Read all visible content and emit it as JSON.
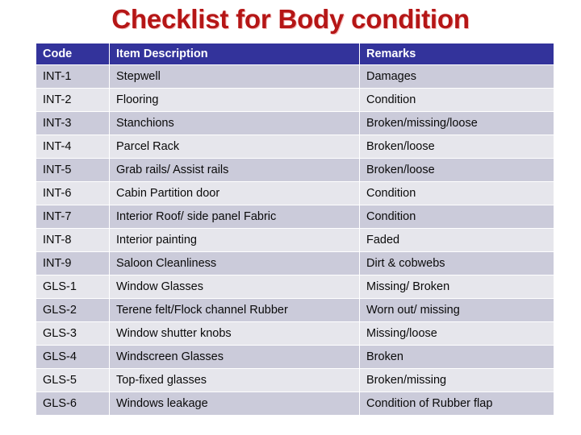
{
  "title": "Checklist for Body condition",
  "colors": {
    "title_text": "#b51616",
    "title_shadow": "#f3b9b9",
    "header_bg": "#33339b",
    "header_text": "#ffffff",
    "row_odd_bg": "#cbcbda",
    "row_even_bg": "#e6e6ec",
    "page_bg": "#ffffff",
    "cell_text": "#0a0a0a"
  },
  "table": {
    "columns": [
      "Code",
      "Item Description",
      "Remarks"
    ],
    "rows": [
      {
        "code": "INT-1",
        "description": "Stepwell",
        "remarks": "Damages"
      },
      {
        "code": "INT-2",
        "description": "Flooring",
        "remarks": "Condition"
      },
      {
        "code": "INT-3",
        "description": "Stanchions",
        "remarks": "Broken/missing/loose"
      },
      {
        "code": "INT-4",
        "description": "Parcel Rack",
        "remarks": "Broken/loose"
      },
      {
        "code": "INT-5",
        "description": "Grab rails/ Assist rails",
        "remarks": "Broken/loose"
      },
      {
        "code": "INT-6",
        "description": "Cabin Partition door",
        "remarks": "Condition"
      },
      {
        "code": "INT-7",
        "description": "Interior Roof/ side panel Fabric",
        "remarks": "Condition"
      },
      {
        "code": "INT-8",
        "description": "Interior painting",
        "remarks": "Faded"
      },
      {
        "code": "INT-9",
        "description": "Saloon Cleanliness",
        "remarks": "Dirt & cobwebs"
      },
      {
        "code": "GLS-1",
        "description": "Window Glasses",
        "remarks": "Missing/ Broken"
      },
      {
        "code": "GLS-2",
        "description": "Terene felt/Flock channel Rubber",
        "remarks": "Worn out/ missing"
      },
      {
        "code": "GLS-3",
        "description": "Window shutter knobs",
        "remarks": "Missing/loose"
      },
      {
        "code": "GLS-4",
        "description": "Windscreen Glasses",
        "remarks": "Broken"
      },
      {
        "code": "GLS-5",
        "description": "Top-fixed glasses",
        "remarks": "Broken/missing"
      },
      {
        "code": "GLS-6",
        "description": "Windows leakage",
        "remarks": "Condition of Rubber flap"
      }
    ]
  }
}
